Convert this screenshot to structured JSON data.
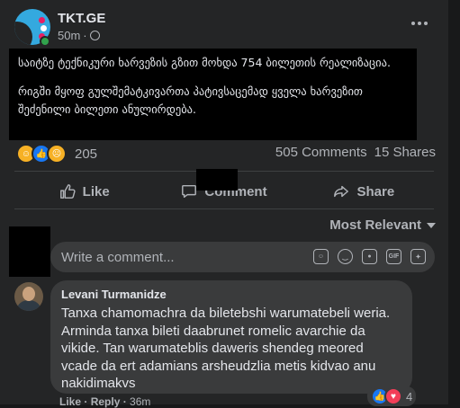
{
  "post": {
    "page_name": "TKT.GE",
    "time": "50m",
    "text_p1": "საიტზე ტექნიკური ხარვეზის გზით მოხდა 754 ბილეთის რეალიზაცია.",
    "text_p2": "რიგში მყოფ გულშემატკივართა პატივსაცემად ყველა ხარვეზით შეძენილი ბილეთი ანულირდება."
  },
  "stats": {
    "reaction_count": "205",
    "comments": "505 Comments",
    "shares": "15 Shares"
  },
  "actions": {
    "like": "Like",
    "comment": "Comment",
    "share": "Share"
  },
  "sort": {
    "label": "Most Relevant"
  },
  "composer": {
    "placeholder": "Write a comment..."
  },
  "comment": {
    "author": "Levani Turmanidze",
    "text": "Tanxa chamomachra da biletebshi warumatebeli weria. Arminda tanxa bileti daabrunet romelic avarchie da vikide. Tan warumateblis daweris shendeg meored vcade da ert adamians arsheudzlia metis kidvao anu nakidimakvs",
    "reaction_count": "4",
    "like_label": "Like",
    "reply_label": "Reply",
    "time": "36m"
  },
  "colors": {
    "background": "#18191a",
    "card": "#242526",
    "bubble": "#3a3b3c",
    "accent_blue": "#1877f2",
    "online_green": "#31a24c"
  },
  "icons": [
    "globe-icon",
    "more-options-icon",
    "like-icon",
    "comment-icon",
    "share-icon",
    "emoji-icon",
    "camera-icon",
    "gif-icon",
    "sticker-icon"
  ]
}
